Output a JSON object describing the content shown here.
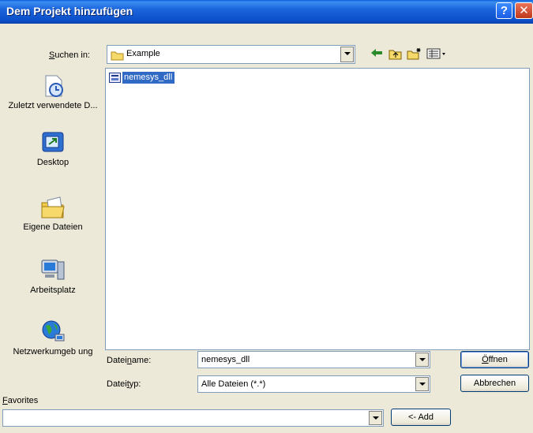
{
  "window": {
    "title": "Dem Projekt hinzufügen",
    "help_glyph": "?",
    "close_glyph": "✕"
  },
  "lookin": {
    "label_pre": "S",
    "label_rest": "uchen in:",
    "value": "Example",
    "tools": [
      "back-arrow-icon",
      "up-folder-icon",
      "new-folder-icon",
      "view-menu-icon"
    ]
  },
  "places": [
    {
      "label": "Zuletzt verwendete D...",
      "icon": "recent-documents-icon"
    },
    {
      "label": "Desktop",
      "icon": "desktop-icon"
    },
    {
      "label": "Eigene Dateien",
      "icon": "my-documents-icon"
    },
    {
      "label": "Arbeitsplatz",
      "icon": "my-computer-icon"
    },
    {
      "label": "Netzwerkumgeb ung",
      "icon": "network-places-icon"
    }
  ],
  "files": [
    {
      "name": "nemesys_dll",
      "selected": true
    }
  ],
  "filename": {
    "label_pre": "Datei",
    "label_u": "n",
    "label_post": "ame:",
    "value": "nemesys_dll"
  },
  "filetype": {
    "label_pre": "Datei",
    "label_u": "t",
    "label_post": "yp:",
    "value": "Alle Dateien (*.*)"
  },
  "buttons": {
    "open_u": "Ö",
    "open_rest": "ffnen",
    "cancel": "Abbrechen",
    "add": "<- Add"
  },
  "favorites": {
    "label_u": "F",
    "label_rest": "avorites",
    "value": ""
  }
}
